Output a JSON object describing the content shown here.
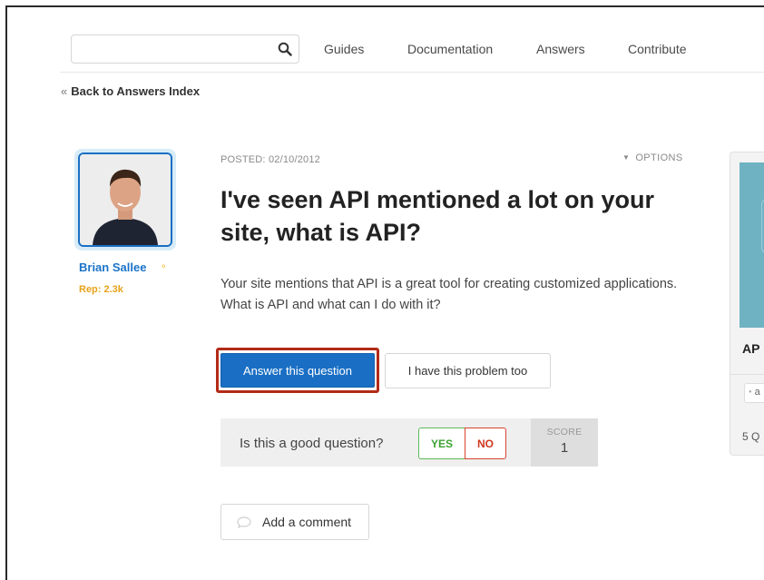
{
  "search": {
    "placeholder": "",
    "icon": "search-icon"
  },
  "nav": {
    "items": [
      {
        "label": "Guides"
      },
      {
        "label": "Documentation"
      },
      {
        "label": "Answers"
      },
      {
        "label": "Contribute"
      }
    ]
  },
  "back_link": {
    "quote": "«",
    "label": "Back to Answers Index"
  },
  "author": {
    "name": "Brian Sallee",
    "rep": "Rep: 2.3k",
    "avatar_icon": "avatar"
  },
  "post": {
    "posted": "POSTED: 02/10/2012",
    "options_label": "OPTIONS",
    "title": "I've seen API mentioned a lot on your site, what is API?",
    "body": "Your site mentions that API is a great tool for creating customized applications. What is API and what can I do with it?"
  },
  "actions": {
    "answer_label": "Answer this question",
    "problem_label": "I have this problem too"
  },
  "vote": {
    "question": "Is this a good question?",
    "yes_label": "YES",
    "no_label": "NO",
    "score_label": "SCORE",
    "score_value": "1"
  },
  "comment": {
    "label": "Add a comment",
    "icon": "speech-bubble-icon"
  },
  "sidebar": {
    "title_partial": "AP",
    "tag_partial": "a",
    "count_partial": "5 Q"
  },
  "colors": {
    "accent": "#1a6fc4",
    "highlight_outline": "#b22a17",
    "rep": "#e8a21a",
    "yes": "#3ea334",
    "no": "#cf3620"
  }
}
